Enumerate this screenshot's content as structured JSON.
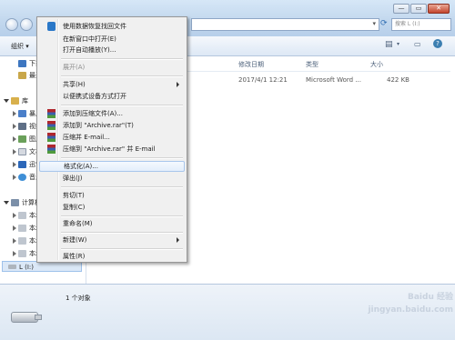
{
  "window": {
    "address_placeholder": "",
    "search_placeholder": "搜索 L (I:)",
    "controls": [
      "—",
      "▭",
      "✕"
    ]
  },
  "toolbar": {
    "organize_label": "组织 ▾"
  },
  "columns": {
    "date": "修改日期",
    "type": "类型",
    "size": "大小"
  },
  "file_row": {
    "date": "2017/4/1 12:21",
    "type": "Microsoft Word ...",
    "size": "422 KB"
  },
  "sidebar": {
    "favorites": [
      {
        "label": "下载",
        "icon": "download-icon"
      },
      {
        "label": "最近",
        "icon": "recent-icon"
      }
    ],
    "library_label": "库",
    "libraries": [
      {
        "label": "暴风",
        "icon": "video-library-icon"
      },
      {
        "label": "视频",
        "icon": "video-icon"
      },
      {
        "label": "图片",
        "icon": "picture-icon"
      },
      {
        "label": "文档",
        "icon": "document-icon"
      },
      {
        "label": "迅雷",
        "icon": "thunder-icon"
      },
      {
        "label": "音乐",
        "icon": "music-icon"
      }
    ],
    "computer_label": "计算机",
    "drives": [
      {
        "label": "本地"
      },
      {
        "label": "本地"
      },
      {
        "label": "本地"
      },
      {
        "label": "本地"
      },
      {
        "label": "本地"
      }
    ],
    "usb_drive": "L (I:)"
  },
  "context_menu": {
    "items": [
      {
        "label": "使用数据恢复找回文件",
        "icon": "recovery-icon"
      },
      {
        "label": "在新窗口中打开(E)"
      },
      {
        "label": "打开自动播放(Y)..."
      },
      {
        "label": "展开(A)",
        "disabled": true
      },
      {
        "label": "共享(H)",
        "submenu": true
      },
      {
        "label": "以便携式设备方式打开"
      },
      {
        "label": "添加到压缩文件(A)...",
        "icon": "winrar-icon"
      },
      {
        "label": "添加到 \"Archive.rar\"(T)",
        "icon": "winrar-icon"
      },
      {
        "label": "压缩并 E-mail...",
        "icon": "winrar-icon"
      },
      {
        "label": "压缩到 \"Archive.rar\" 并 E-mail",
        "icon": "winrar-icon"
      },
      {
        "label": "格式化(A)...",
        "highlighted": true
      },
      {
        "label": "弹出(J)"
      },
      {
        "label": "剪切(T)"
      },
      {
        "label": "复制(C)"
      },
      {
        "label": "重命名(M)"
      },
      {
        "label": "新建(W)",
        "submenu": true
      },
      {
        "label": "属性(R)"
      }
    ]
  },
  "status": {
    "count": "1 个对象"
  },
  "watermark": "Baidu 经验 jingyan.baidu.com",
  "colors": {
    "accent": "#3c7fb1",
    "menu_bg": "#f0f0f0",
    "highlight_border": "#a8c6ec",
    "winrar_red": "#b0272d"
  }
}
